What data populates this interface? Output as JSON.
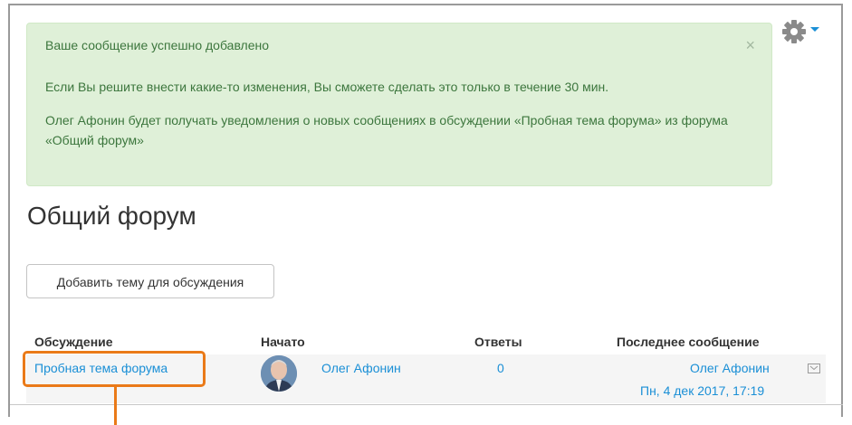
{
  "alert": {
    "line1": "Ваше сообщение успешно добавлено",
    "line2": "Если Вы решите внести какие-то изменения, Вы сможете сделать это только в течение 30 мин.",
    "line3": "Олег Афонин будет получать уведомления о новых сообщениях в обсуждении «Пробная тема форума» из форума «Общий форум»",
    "close": "×"
  },
  "page_title": "Общий форум",
  "add_topic_button": "Добавить тему для обсуждения",
  "table": {
    "headers": [
      "Обсуждение",
      "Начато",
      "Ответы",
      "Последнее сообщение"
    ],
    "rows": [
      {
        "discussion": "Пробная тема форума",
        "started_by": "Олег Афонин",
        "replies": "0",
        "last_post_author": "Олег Афонин",
        "last_post_date": "Пн, 4 дек 2017, 17:19"
      }
    ]
  },
  "icons": {
    "settings": "gear-icon",
    "dropdown": "caret-down-icon",
    "subscribe": "envelope-icon"
  },
  "colors": {
    "alert_bg": "#dff0d8",
    "alert_text": "#3c763d",
    "link": "#1a8fd6",
    "highlight": "#ea7a18"
  }
}
